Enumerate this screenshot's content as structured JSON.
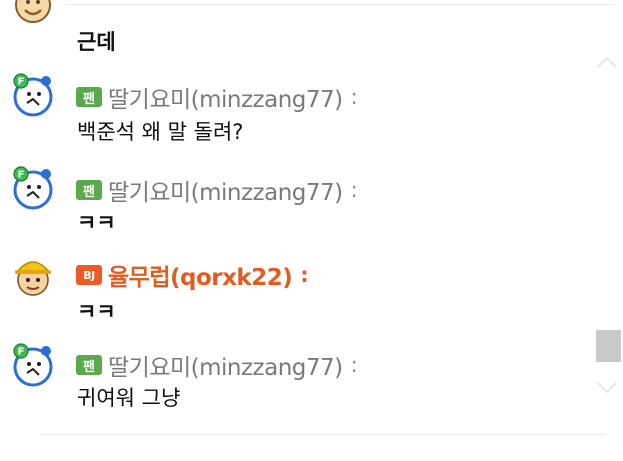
{
  "messages": [
    {
      "type": "text-only",
      "avatar": "smiley-avatar-icon",
      "text": "근데"
    },
    {
      "type": "fan",
      "badge": "팬",
      "nickname": "딸기요미(minzzang77)",
      "colon": ":",
      "text": "백준석 왜 말 돌려?"
    },
    {
      "type": "fan",
      "badge": "팬",
      "nickname": "딸기요미(minzzang77)",
      "colon": ":",
      "text": "ㅋㅋ"
    },
    {
      "type": "bj",
      "badge": "BJ",
      "nickname": "율무럽(qorxk22)",
      "colon": ":",
      "text": "ㅋㅋ"
    },
    {
      "type": "fan",
      "badge": "팬",
      "nickname": "딸기요미(minzzang77)",
      "colon": ":",
      "text": "귀여워 그냥"
    }
  ],
  "icons": {
    "fan_avatar": "alarm-clock-fan-avatar-icon",
    "bj_avatar": "worker-helmet-avatar-icon",
    "scroll_up": "chevron-up-icon",
    "scroll_down": "chevron-down-icon"
  },
  "colors": {
    "fan_badge": "#5aaa4c",
    "bj_badge": "#ee5a24",
    "bj_nickname": "#e25b1f",
    "fan_nickname": "#7a7a7a",
    "scroll_thumb": "#c9c9c9"
  }
}
